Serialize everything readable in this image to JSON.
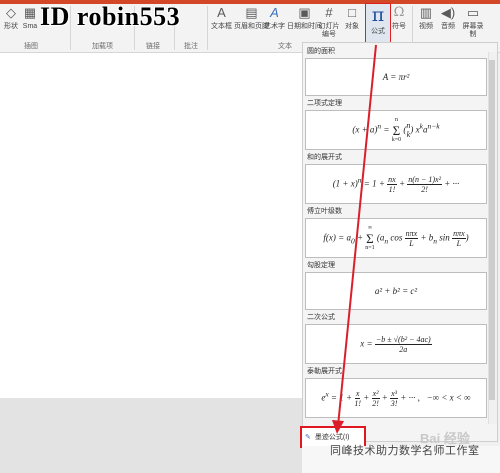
{
  "watermark": "ID robin553",
  "ribbon": {
    "buttons": [
      {
        "label": "形状",
        "icon": "shapes-icon"
      },
      {
        "label": "Sma",
        "icon": "smartart-icon"
      },
      {
        "label": "文本框",
        "icon": "textbox-icon"
      },
      {
        "label": "页眉和页脚",
        "icon": "header-footer-icon"
      },
      {
        "label": "艺术字",
        "icon": "wordart-icon"
      },
      {
        "label": "日期和时间",
        "icon": "date-time-icon"
      },
      {
        "label": "幻灯片编号",
        "icon": "slide-number-icon"
      },
      {
        "label": "对象",
        "icon": "object-icon"
      },
      {
        "label": "公式",
        "icon": "pi-icon"
      },
      {
        "label": "符号",
        "icon": "omega-icon"
      },
      {
        "label": "视频",
        "icon": "video-icon"
      },
      {
        "label": "音频",
        "icon": "audio-icon"
      },
      {
        "label": "屏幕录制",
        "icon": "screen-record-icon"
      }
    ],
    "groups": [
      "插图",
      "加载项",
      "链接",
      "批注",
      "文本"
    ]
  },
  "gallery": {
    "items": [
      {
        "title": "圆的面积"
      },
      {
        "title": "二项式定理"
      },
      {
        "title": "和的展开式"
      },
      {
        "title": "傅立叶级数"
      },
      {
        "title": "勾股定理"
      },
      {
        "title": "二次公式"
      },
      {
        "title": "泰勒展开式"
      }
    ],
    "save_item": "墨迹公式(I)"
  },
  "overlay": {
    "wechat": "同峰技术助力数学名师工作室",
    "baidu": "Bai 经验"
  }
}
